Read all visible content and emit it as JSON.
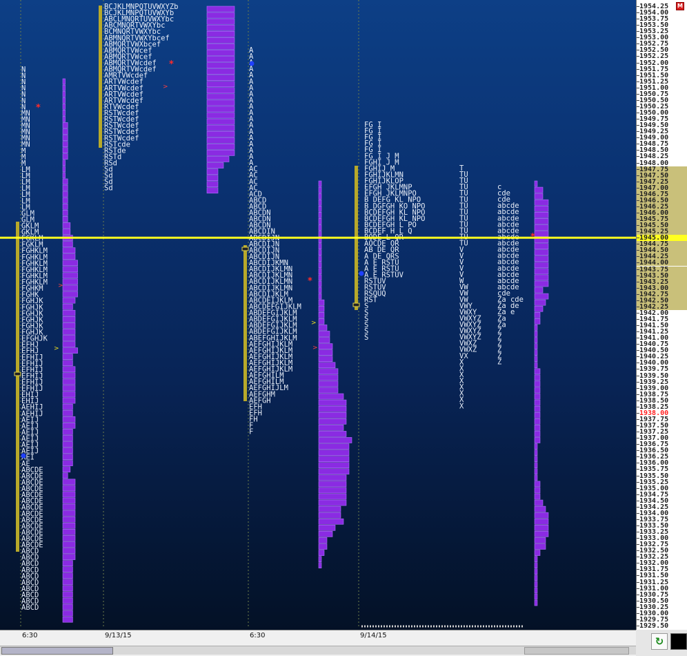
{
  "price_axis": {
    "top_price": 1954.25,
    "tick_size": 0.25,
    "value_area_high": 1947.75,
    "value_area_low": 1942.25,
    "current_price": 1945.0,
    "reference_price": 1938.0,
    "menu_label": "M"
  },
  "session_dates": [
    "6:30",
    "9/13/15",
    "6:30",
    "9/14/15"
  ],
  "profiles": [
    {
      "name": "profile-1",
      "letters": [
        "N",
        "N",
        "N",
        "N",
        "N",
        "N",
        "N",
        "MN",
        "MN",
        "MN",
        "MN",
        "MN",
        "MN",
        "M",
        "M",
        "M",
        "LM",
        "LM",
        "LM",
        "LM",
        "LM",
        "LM",
        "LM",
        "GLM",
        "GLM",
        "GKLM",
        "GKLM",
        "FGKLM",
        "FGKLM",
        "FGHKLM",
        "FGHKLM",
        "FGHKLM",
        "FGHKLM",
        "FGHKLM",
        "FGHKLM",
        "FGHKM",
        "FGHK",
        "FGHJK",
        "FGHJK",
        "FGHJK",
        "FGHJK",
        "FGHJK",
        "FGHJK",
        "EFGHJK",
        "EFHJ",
        "EFHJ",
        "EFHIJ",
        "EFHIJ",
        "EFHIJ",
        "EFHIJ",
        "EFHIJ",
        "EFHIJ",
        "EHIJ",
        "EHIJ",
        "AEHIJ",
        "AEHIJ",
        "AEIJ",
        "AEIJ",
        "AEIJ",
        "AEIJ",
        "AEIJ",
        "AEIJ",
        "AEI",
        "AE",
        "ABCDE",
        "ABCDE",
        "ABCDE",
        "ABCDE",
        "ABCDE",
        "ABCDE",
        "ABCDE",
        "ABCDE",
        "ABCDE",
        "ABCDE",
        "ABCDE",
        "ABCDE",
        "ABCDE",
        "ABCD",
        "ABCD",
        "ABCD",
        "ABCD",
        "ABCD",
        "ABCD",
        "ABCD",
        "ABCD",
        "ABCD",
        "ABCD"
      ]
    },
    {
      "name": "profile-2",
      "letters": [
        "BCJKLMNPQTUVWXYZb",
        "BCJKLMNPQTUVWXYb",
        "ABCLMNQRTUVWXYbc",
        "ABCMNQRTVWXYbc",
        "BCMNQRTVWXYbc",
        "ABMNQRTVWXYbcef",
        "ABMQRTVWXbcef",
        "ABMQRTVWcef",
        "ABMQRTVWcef",
        "ABMQRTVWcdef",
        "ABMQRTVWcdef",
        "AMRTVWcdef",
        "ARTVWcdef",
        "ARTVWcdef",
        "ARTVWcdef",
        "ARTVWcdef",
        "RTVWcdef",
        "RSTWcdef",
        "RSTWcdef",
        "RSTWcdef",
        "RSTWcdef",
        "RSTWcdef",
        "RSTcde",
        "RSTde",
        "RSTd",
        "RSd",
        "Sd",
        "Sd",
        "Sd",
        "Sd"
      ]
    },
    {
      "name": "profile-3",
      "letters": [
        "A",
        "A",
        "A",
        "A",
        "A",
        "A",
        "A",
        "A",
        "A",
        "A",
        "A",
        "A",
        "A",
        "A",
        "A",
        "A",
        "A",
        "A",
        "A",
        "AC",
        "AC",
        "AC",
        "AC",
        "ACD",
        "ABCD",
        "ABCD",
        "ABCDN",
        "ABCDN",
        "ABCDN",
        "ABCDIN",
        "ABCDIJN",
        "ABCDIJN",
        "ABCDIJN",
        "ABCDIJN",
        "ABCDIJKMN",
        "ABCDIJKLMN",
        "ABCDIJKLMN",
        "ABCDIJKLMN",
        "ABCDIJKLMN",
        "ABCDIJKLM",
        "ABCDEIJKLM",
        "ABCDEFGIJKLM",
        "ABDEFGIJKLM",
        "ABDEFGIJKLM",
        "ABDEFGIJKLM",
        "ABDEFGIJKLM",
        "ABEFGHIJKLM",
        "AEFGHIJKLM",
        "AEFGHIJKLM",
        "AEFGHIJKLM",
        "AEFGHIJKLM",
        "AEFGHIJKLM",
        "AEFGHILM",
        "AEFGHILM",
        "AEFGHIJLM",
        "AEFGHM",
        "AEFGH",
        "EFH",
        "EFH",
        "FH",
        "F",
        "F"
      ]
    },
    {
      "name": "profile-4",
      "letters": [
        "FG I",
        "FG I",
        "FG I",
        "FG I",
        "FG I",
        "FG I J  M",
        "FGHI J  M",
        "FGHIJ  M",
        "FGHIJKLMN",
        "FGHIJKLOP",
        "EFGH JKLMNP",
        "EFGH JKLMNPO",
        "B DEFG KL NPO",
        "B DGFGH KO NPO",
        "BCDEFGH KL NPO",
        "BCDEFGH KL NPO",
        "BCDEFGH  L  PO",
        "BCDEF   H  L  Q",
        "BODE     L  QR",
        "AOCDE      OR",
        "AB DE      QR",
        "A  DE      QRS",
        "A  E       RSTU",
        "A  E       RSTU",
        "A  E       RSTUV",
        "           RSTUV",
        "           RSTUV",
        "           RSQUQ",
        "           RST",
        "           S",
        "           S",
        "           S",
        "           S",
        "           S",
        "           S"
      ]
    },
    {
      "name": "profile-5",
      "letters": [
        "T",
        "TU",
        "TU",
        "TU",
        "TU",
        "TU",
        "TU",
        "TU",
        "TU",
        "TU",
        "TU",
        "TU",
        "TU",
        "V",
        "V",
        "V",
        "V",
        "V",
        "W",
        "VW",
        "VW",
        "VW",
        "VWY",
        "VWXY",
        "VWXYZ",
        "VWXYZ",
        "VWXYZ",
        "VWXYZ",
        "VWXZ",
        "VWXZ",
        "VX",
        "X",
        "X",
        "X",
        "X",
        "X",
        "X",
        "X",
        "X"
      ]
    },
    {
      "name": "profile-6",
      "letters": [
        "c",
        "cde",
        "cde",
        "abcde",
        "abcde",
        "abcde",
        "abcde",
        "abcde",
        "abcde",
        "abcde",
        "abcde",
        "abcde",
        "abcde",
        "abcde",
        "abcde",
        "abcde",
        "abcde",
        "cde",
        "Za cde",
        "Za de",
        "Za e",
        "Za",
        "Za",
        "Z",
        "Z",
        "Z",
        "Z",
        "Z",
        "Z"
      ]
    }
  ],
  "bottom": {
    "refresh_icon": "refresh-icon",
    "black_button": "square"
  }
}
